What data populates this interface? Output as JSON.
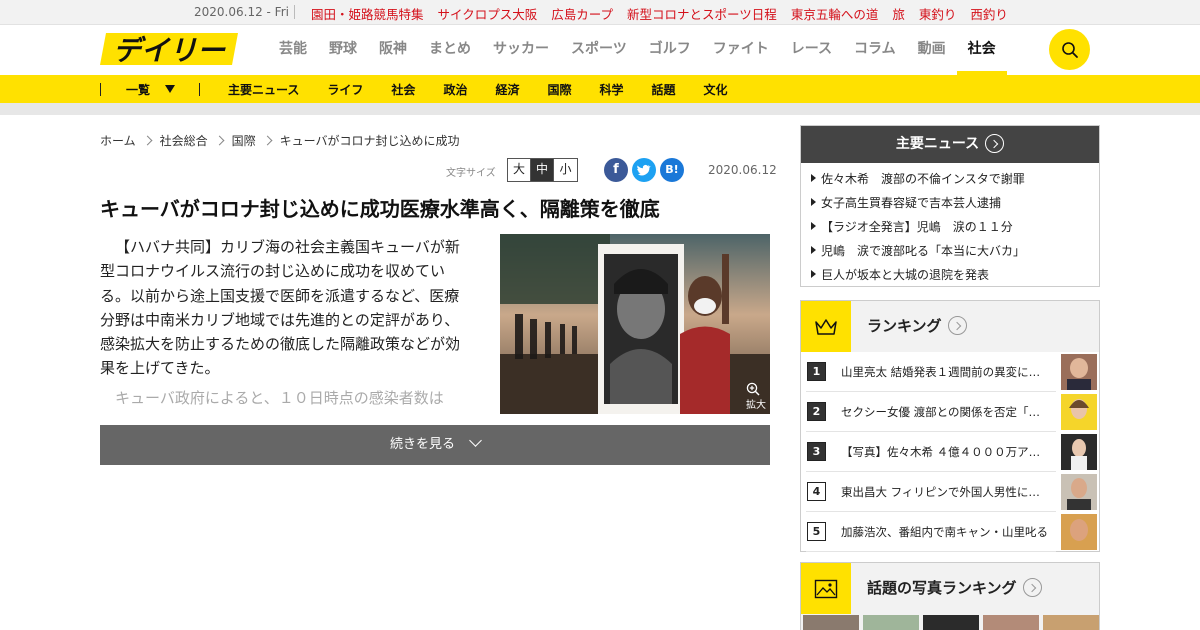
{
  "topbar": {
    "date": "2020.06.12 - Fri",
    "links": [
      "園田・姫路競馬特集",
      "サイクロプス大阪",
      "広島カープ",
      "新型コロナとスポーツ日程",
      "東京五輪への道",
      "旅",
      "東釣り",
      "西釣り"
    ]
  },
  "header": {
    "logo_text": "デイリー",
    "nav": [
      "芸能",
      "野球",
      "阪神",
      "まとめ",
      "サッカー",
      "スポーツ",
      "ゴルフ",
      "ファイト",
      "レース",
      "コラム",
      "動画",
      "社会"
    ],
    "active_nav": "社会"
  },
  "subnav": {
    "menu_label": "一覧",
    "links": [
      "主要ニュース",
      "ライフ",
      "社会",
      "政治",
      "経済",
      "国際",
      "科学",
      "話題",
      "文化"
    ]
  },
  "breadcrumb": [
    "ホーム",
    "社会総合",
    "国際",
    "キューバがコロナ封じ込めに成功"
  ],
  "fontsize": {
    "label": "文字サイズ",
    "options": [
      "大",
      "中",
      "小"
    ],
    "selected": "中"
  },
  "share": {
    "facebook": "f",
    "twitter": "t",
    "hatena": "B!"
  },
  "article": {
    "date": "2020.06.12",
    "headline": "キューバがコロナ封じ込めに成功医療水準高く、隔離策を徹底",
    "paragraph1": "【ハバナ共同】カリブ海の社会主義国キューバが新型コロナウイルス流行の封じ込めに成功を収めている。以前から途上国支援で医師を派遣するなど、医療分野は中南米カリブ地域では先進的との定評があり、感染拡大を防止するための徹底した隔離政策などが効果を上げてきた。",
    "paragraph2": "キューバ政府によると、１０日時点の感染者数は",
    "zoom_label": "拡大",
    "read_more": "続きを見る"
  },
  "main_news": {
    "title": "主要ニュース",
    "items": [
      "佐々木希　渡部の不倫インスタで謝罪",
      "女子高生買春容疑で吉本芸人逮捕",
      "【ラジオ全発言】児嶋　涙の１１分",
      "児嶋　涙で渡部叱る「本当に大バカ」",
      "巨人が坂本と大城の退院を発表"
    ]
  },
  "ranking": {
    "title": "ランキング",
    "items": [
      {
        "rank": "1",
        "text": "山里亮太 結婚発表１週間前の異変に…"
      },
      {
        "rank": "2",
        "text": "セクシー女優 渡部との関係を否定「…"
      },
      {
        "rank": "3",
        "text": "【写真】佐々木希 ４億４０００万ア…"
      },
      {
        "rank": "4",
        "text": "東出昌大 フィリピンで外国人男性に…"
      },
      {
        "rank": "5",
        "text": "加藤浩次、番組内で南キャン・山里叱る"
      }
    ]
  },
  "photo_ranking": {
    "title": "話題の写真ランキング"
  },
  "colors": {
    "brand_yellow": "#ffe100",
    "accent_red": "#d4101a",
    "dark": "#444444"
  }
}
